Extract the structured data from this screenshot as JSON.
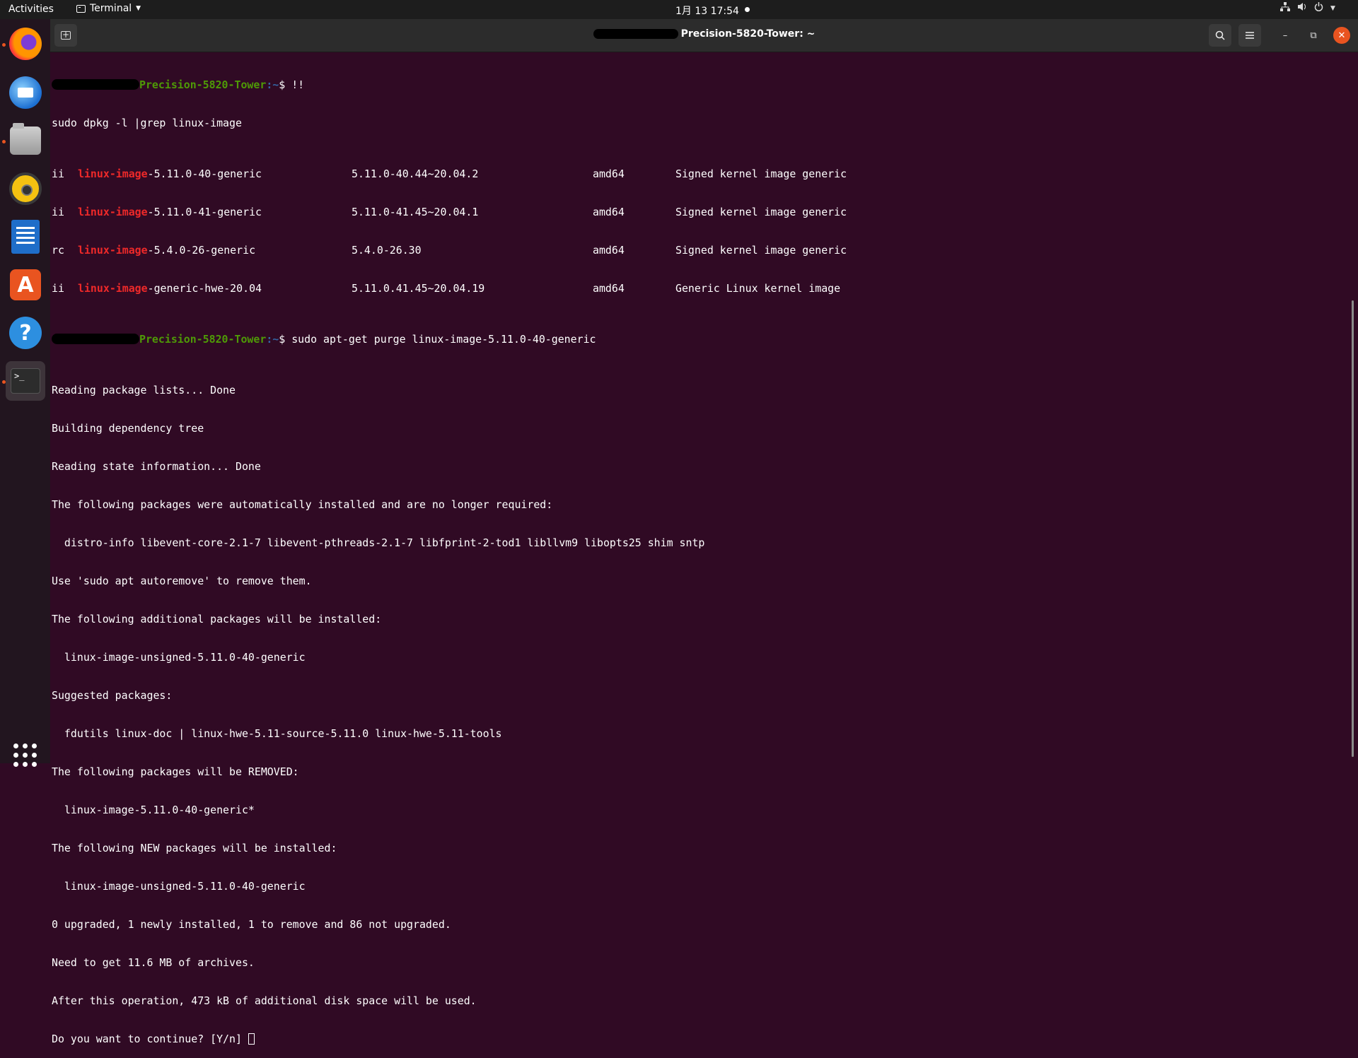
{
  "topbar": {
    "activities": "Activities",
    "app_name": "Terminal",
    "clock": "1月 13  17:54"
  },
  "dock": {
    "items": [
      "firefox",
      "thunderbird",
      "files",
      "rhythmbox",
      "libreoffice-writer",
      "ubuntu-software",
      "help",
      "terminal"
    ],
    "software_glyph": "A",
    "help_glyph": "?",
    "terminal_glyph": ">_"
  },
  "window": {
    "title": "Precision-5820-Tower: ~",
    "buttons": {
      "minimize": "–",
      "maximize": "⧉",
      "close": "✕"
    }
  },
  "terminal": {
    "prompt_host": "Precision-5820-Tower",
    "prompt_path": ":~",
    "prompt_sep": "$ ",
    "cmd1": "!!",
    "line_dpkg": "sudo dpkg -l |grep linux-image",
    "hl_word": "linux-image",
    "dpkg_rows": [
      {
        "state": "ii",
        "rest": "-5.11.0-40-generic",
        "version": "5.11.0-40.44~20.04.2",
        "arch": "amd64",
        "desc": "Signed kernel image generic"
      },
      {
        "state": "ii",
        "rest": "-5.11.0-41-generic",
        "version": "5.11.0-41.45~20.04.1",
        "arch": "amd64",
        "desc": "Signed kernel image generic"
      },
      {
        "state": "rc",
        "rest": "-5.4.0-26-generic",
        "version": "5.4.0-26.30",
        "arch": "amd64",
        "desc": "Signed kernel image generic"
      },
      {
        "state": "ii",
        "rest": "-generic-hwe-20.04",
        "version": "5.11.0.41.45~20.04.19",
        "arch": "amd64",
        "desc": "Generic Linux kernel image"
      }
    ],
    "cmd2": "sudo apt-get purge linux-image-5.11.0-40-generic",
    "output": [
      "Reading package lists... Done",
      "Building dependency tree",
      "Reading state information... Done",
      "The following packages were automatically installed and are no longer required:",
      "  distro-info libevent-core-2.1-7 libevent-pthreads-2.1-7 libfprint-2-tod1 libllvm9 libopts25 shim sntp",
      "Use 'sudo apt autoremove' to remove them.",
      "The following additional packages will be installed:",
      "  linux-image-unsigned-5.11.0-40-generic",
      "Suggested packages:",
      "  fdutils linux-doc | linux-hwe-5.11-source-5.11.0 linux-hwe-5.11-tools",
      "The following packages will be REMOVED:",
      "  linux-image-5.11.0-40-generic*",
      "The following NEW packages will be installed:",
      "  linux-image-unsigned-5.11.0-40-generic",
      "0 upgraded, 1 newly installed, 1 to remove and 86 not upgraded.",
      "Need to get 11.6 MB of archives.",
      "After this operation, 473 kB of additional disk space will be used."
    ],
    "confirm_prompt": "Do you want to continue? [Y/n] "
  }
}
